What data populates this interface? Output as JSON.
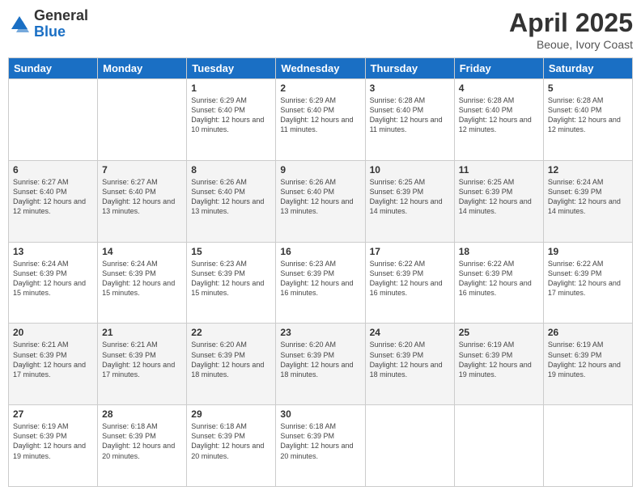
{
  "logo": {
    "general": "General",
    "blue": "Blue"
  },
  "title": "April 2025",
  "subtitle": "Beoue, Ivory Coast",
  "days_header": [
    "Sunday",
    "Monday",
    "Tuesday",
    "Wednesday",
    "Thursday",
    "Friday",
    "Saturday"
  ],
  "weeks": [
    [
      {
        "num": "",
        "info": ""
      },
      {
        "num": "",
        "info": ""
      },
      {
        "num": "1",
        "info": "Sunrise: 6:29 AM\nSunset: 6:40 PM\nDaylight: 12 hours and 10 minutes."
      },
      {
        "num": "2",
        "info": "Sunrise: 6:29 AM\nSunset: 6:40 PM\nDaylight: 12 hours and 11 minutes."
      },
      {
        "num": "3",
        "info": "Sunrise: 6:28 AM\nSunset: 6:40 PM\nDaylight: 12 hours and 11 minutes."
      },
      {
        "num": "4",
        "info": "Sunrise: 6:28 AM\nSunset: 6:40 PM\nDaylight: 12 hours and 12 minutes."
      },
      {
        "num": "5",
        "info": "Sunrise: 6:28 AM\nSunset: 6:40 PM\nDaylight: 12 hours and 12 minutes."
      }
    ],
    [
      {
        "num": "6",
        "info": "Sunrise: 6:27 AM\nSunset: 6:40 PM\nDaylight: 12 hours and 12 minutes."
      },
      {
        "num": "7",
        "info": "Sunrise: 6:27 AM\nSunset: 6:40 PM\nDaylight: 12 hours and 13 minutes."
      },
      {
        "num": "8",
        "info": "Sunrise: 6:26 AM\nSunset: 6:40 PM\nDaylight: 12 hours and 13 minutes."
      },
      {
        "num": "9",
        "info": "Sunrise: 6:26 AM\nSunset: 6:40 PM\nDaylight: 12 hours and 13 minutes."
      },
      {
        "num": "10",
        "info": "Sunrise: 6:25 AM\nSunset: 6:39 PM\nDaylight: 12 hours and 14 minutes."
      },
      {
        "num": "11",
        "info": "Sunrise: 6:25 AM\nSunset: 6:39 PM\nDaylight: 12 hours and 14 minutes."
      },
      {
        "num": "12",
        "info": "Sunrise: 6:24 AM\nSunset: 6:39 PM\nDaylight: 12 hours and 14 minutes."
      }
    ],
    [
      {
        "num": "13",
        "info": "Sunrise: 6:24 AM\nSunset: 6:39 PM\nDaylight: 12 hours and 15 minutes."
      },
      {
        "num": "14",
        "info": "Sunrise: 6:24 AM\nSunset: 6:39 PM\nDaylight: 12 hours and 15 minutes."
      },
      {
        "num": "15",
        "info": "Sunrise: 6:23 AM\nSunset: 6:39 PM\nDaylight: 12 hours and 15 minutes."
      },
      {
        "num": "16",
        "info": "Sunrise: 6:23 AM\nSunset: 6:39 PM\nDaylight: 12 hours and 16 minutes."
      },
      {
        "num": "17",
        "info": "Sunrise: 6:22 AM\nSunset: 6:39 PM\nDaylight: 12 hours and 16 minutes."
      },
      {
        "num": "18",
        "info": "Sunrise: 6:22 AM\nSunset: 6:39 PM\nDaylight: 12 hours and 16 minutes."
      },
      {
        "num": "19",
        "info": "Sunrise: 6:22 AM\nSunset: 6:39 PM\nDaylight: 12 hours and 17 minutes."
      }
    ],
    [
      {
        "num": "20",
        "info": "Sunrise: 6:21 AM\nSunset: 6:39 PM\nDaylight: 12 hours and 17 minutes."
      },
      {
        "num": "21",
        "info": "Sunrise: 6:21 AM\nSunset: 6:39 PM\nDaylight: 12 hours and 17 minutes."
      },
      {
        "num": "22",
        "info": "Sunrise: 6:20 AM\nSunset: 6:39 PM\nDaylight: 12 hours and 18 minutes."
      },
      {
        "num": "23",
        "info": "Sunrise: 6:20 AM\nSunset: 6:39 PM\nDaylight: 12 hours and 18 minutes."
      },
      {
        "num": "24",
        "info": "Sunrise: 6:20 AM\nSunset: 6:39 PM\nDaylight: 12 hours and 18 minutes."
      },
      {
        "num": "25",
        "info": "Sunrise: 6:19 AM\nSunset: 6:39 PM\nDaylight: 12 hours and 19 minutes."
      },
      {
        "num": "26",
        "info": "Sunrise: 6:19 AM\nSunset: 6:39 PM\nDaylight: 12 hours and 19 minutes."
      }
    ],
    [
      {
        "num": "27",
        "info": "Sunrise: 6:19 AM\nSunset: 6:39 PM\nDaylight: 12 hours and 19 minutes."
      },
      {
        "num": "28",
        "info": "Sunrise: 6:18 AM\nSunset: 6:39 PM\nDaylight: 12 hours and 20 minutes."
      },
      {
        "num": "29",
        "info": "Sunrise: 6:18 AM\nSunset: 6:39 PM\nDaylight: 12 hours and 20 minutes."
      },
      {
        "num": "30",
        "info": "Sunrise: 6:18 AM\nSunset: 6:39 PM\nDaylight: 12 hours and 20 minutes."
      },
      {
        "num": "",
        "info": ""
      },
      {
        "num": "",
        "info": ""
      },
      {
        "num": "",
        "info": ""
      }
    ]
  ]
}
